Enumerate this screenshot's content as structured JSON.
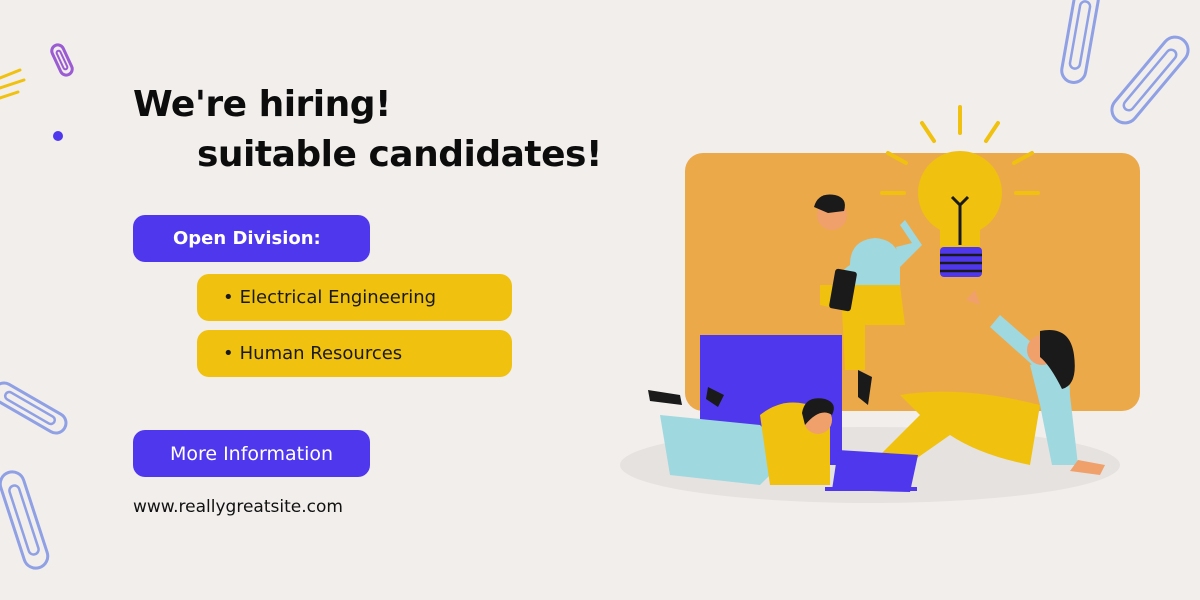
{
  "headline": {
    "line1": "We're hiring!",
    "line2": "suitable candidates!"
  },
  "open_division": {
    "label": "Open Division:",
    "items": [
      {
        "bullet": "•",
        "label": "Electrical Engineering"
      },
      {
        "bullet": "•",
        "label": "Human Resources"
      }
    ]
  },
  "cta": {
    "label": "More Information"
  },
  "website": "www.reallygreatsite.com",
  "colors": {
    "background": "#f1eeec",
    "accent_blue": "#4f37ee",
    "accent_yellow": "#f0c10f",
    "panel_orange": "#eba94a",
    "paperclip_blue": "#8fa0e4",
    "paperclip_purple": "#9a5bd3"
  },
  "illustration": {
    "icons": [
      "light-bulb-icon",
      "tablet-icon",
      "laptop-icon",
      "paperclip-icon"
    ],
    "people_count": 3
  }
}
